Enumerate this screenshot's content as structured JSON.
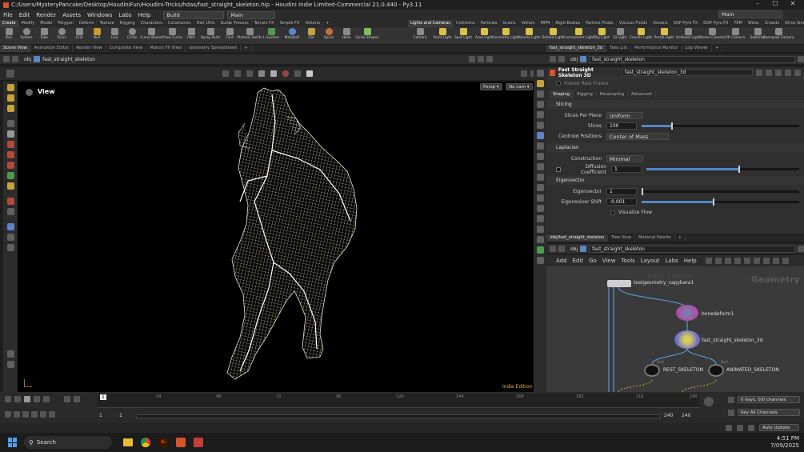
{
  "window": {
    "title": "C:/Users/MysteryPancake/Desktop/HoudiniFun/Houdini-Tricks/hdas/fast_straight_skeleton.hip - Houdini Indie Limited-Commercial 21.0.440 - Py3.11",
    "min": "–",
    "max": "☐",
    "close": "✕"
  },
  "menu": {
    "items": [
      "File",
      "Edit",
      "Render",
      "Assets",
      "Windows",
      "Labs",
      "Help"
    ],
    "build": "Build",
    "main_desk": "Main",
    "main_right": "Main"
  },
  "shelf_tabs_left": [
    "Create",
    "Modify",
    "Model",
    "Polygon",
    "Deform",
    "Texture",
    "Rigging",
    "Characters",
    "Constraints",
    "Hair Utils",
    "Guide Process",
    "Terrain FX",
    "Simple FX",
    "Volume",
    "+"
  ],
  "shelf_tabs_right": [
    "Lights and Cameras",
    "Collisions",
    "Particles",
    "Grains",
    "Vellum",
    "MPM",
    "Rigid Bodies",
    "Particle Fluids",
    "Viscous Fluids",
    "Oceans",
    "SOP Pyro FX",
    "DOP Pyro FX",
    "FEM",
    "Wires",
    "Crowds",
    "Drive Simulation"
  ],
  "tools_left": [
    "Box",
    "Sphere",
    "Tube",
    "Torus",
    "Grid",
    "Null",
    "Line",
    "Circle",
    "Curve Bezier",
    "Draw Curve",
    "Path",
    "Spray Paint",
    "Font",
    "Platonic Solids",
    "L-System",
    "Metaball",
    "File",
    "Spiral",
    "Helix",
    "Quick Shapes"
  ],
  "tools_right": [
    "Camera",
    "Point Light",
    "Spot Light",
    "Area Light",
    "Geometry Light",
    "Volume Light",
    "Distant Light",
    "Environment Light",
    "Sky Light",
    "GI Light",
    "Caustic Light",
    "Portal Light",
    "Ambient Light",
    "Stereo Camera",
    "VR Camera",
    "Switcher",
    "Gamepad Camera"
  ],
  "left_tabs": [
    "Scene View",
    "Animation Editor",
    "Render View",
    "Composite View",
    "Motion FX View",
    "Geometry Spreadsheet",
    "+"
  ],
  "path": {
    "root": "obj",
    "node": "fast_straight_skeleton"
  },
  "viewport": {
    "label": "View",
    "persp": "Persp ▾",
    "cam": "No cam ▾",
    "watermark": "Indie Edition"
  },
  "param_tabs_top": [
    "fast_straight_skeleton_3d",
    "Take List",
    "Performance Monitor",
    "Log Viewer",
    "+"
  ],
  "param": {
    "node_type": "Fast Straight Skeleton 3D",
    "node_name": "fast_straight_skeleton_3d",
    "freeze": "Freeze Rest Frame",
    "tabs": [
      "Shaping",
      "Rigging",
      "Resampling",
      "Advanced"
    ],
    "slicing": "Slicing",
    "spp_label": "Slices Per Piece",
    "spp_value": "Uniform",
    "slices_label": "Slices",
    "slices_value": "100",
    "cp_label": "Centroid Positions",
    "cp_value": "Center of Mass",
    "laplacian": "Laplacian",
    "construction_label": "Construction",
    "construction_value": "Minimal",
    "diff_label": "Diffusion Coefficient",
    "diff_value": "1",
    "eigen": "Eigenvector",
    "ev_label": "Eigenvector",
    "ev_value": "1",
    "shift_label": "Eigensolver Shift",
    "shift_value": "-0.001",
    "visualize": "Visualize Flow"
  },
  "net_tabs": [
    "/obj/fast_straight_skeleton",
    "Tree View",
    "Material Palette",
    "+"
  ],
  "net_menu": [
    "Add",
    "Edit",
    "Go",
    "View",
    "Tools",
    "Layout",
    "Labs",
    "Help"
  ],
  "net": {
    "watermark": "Indie Edition",
    "context": "Geometry",
    "n1": "testgeometry_capybara1",
    "n2": "bonedeform1",
    "n3": "fast_straight_skeleton_3d",
    "n4": "REST_SKELETON",
    "n5": "ANIMATED_SKELETON",
    "null1": "Null",
    "null2": "Null"
  },
  "timeline": {
    "ticks": [
      "1",
      "24",
      "48",
      "72",
      "96",
      "120",
      "144",
      "168",
      "192",
      "216",
      "240"
    ],
    "current": "1",
    "start": "1",
    "start2": "1",
    "end": "240",
    "end2": "240",
    "keys": "0 keys, 0/0 channels",
    "all_keys": "Key All Channels",
    "auto_update": "Auto Update"
  },
  "taskbar": {
    "search": "Search",
    "time": "4:51 PM",
    "date": "7/09/2025"
  }
}
